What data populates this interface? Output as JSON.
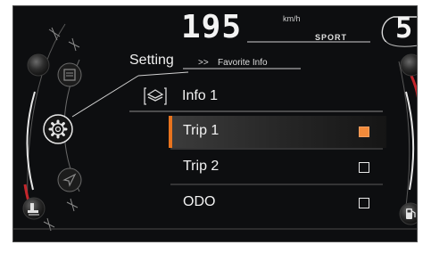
{
  "speedometer": {
    "speed": "195",
    "unit": "km/h",
    "mode": "SPORT",
    "gear": "5"
  },
  "breadcrumb": {
    "section": "Setting",
    "separator": ">>",
    "current": "Favorite Info"
  },
  "panel": {
    "title": "Info 1",
    "items": [
      {
        "label": "Trip 1",
        "checked": true,
        "selected": true
      },
      {
        "label": "Trip  2",
        "checked": false,
        "selected": false
      },
      {
        "label": "ODO",
        "checked": false,
        "selected": false
      }
    ]
  },
  "left_menu": {
    "icons": [
      "list-icon",
      "gear-icon",
      "navigation-icon",
      "tire-pressure-icon"
    ]
  },
  "right_gauge": {
    "icons": [
      "fuel-pump-icon"
    ]
  },
  "colors": {
    "accent": "#e8731e",
    "checkbox_checked": "#f28a3a",
    "background": "#0d0e10",
    "gauge_red": "#c4262c"
  }
}
